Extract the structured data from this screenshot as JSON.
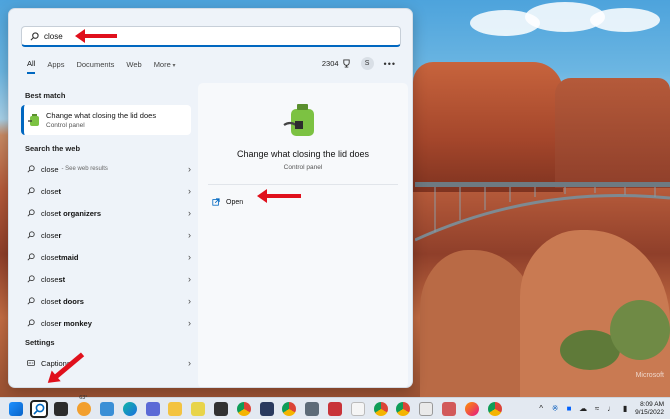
{
  "search": {
    "value": "close"
  },
  "tabs": [
    {
      "label": "All"
    },
    {
      "label": "Apps"
    },
    {
      "label": "Documents"
    },
    {
      "label": "Web"
    },
    {
      "label": "More"
    }
  ],
  "header_right": {
    "points": "2304",
    "avatar_initial": "S",
    "more_label": "•••"
  },
  "best_match": {
    "section_title": "Best match",
    "title": "Change what closing the lid does",
    "subtitle": "Control panel"
  },
  "web": {
    "section_title": "Search the web",
    "items": [
      {
        "prefix": "close",
        "bold": "",
        "sub": "- See web results"
      },
      {
        "prefix": "close",
        "bold": "t",
        "sub": ""
      },
      {
        "prefix": "close",
        "bold": "t organizers",
        "sub": ""
      },
      {
        "prefix": "close",
        "bold": "r",
        "sub": ""
      },
      {
        "prefix": "close",
        "bold": "tmaid",
        "sub": ""
      },
      {
        "prefix": "close",
        "bold": "st",
        "sub": ""
      },
      {
        "prefix": "close",
        "bold": "t doors",
        "sub": ""
      },
      {
        "prefix": "close",
        "bold": "r monkey",
        "sub": ""
      }
    ]
  },
  "settings": {
    "section_title": "Settings",
    "items": [
      {
        "label": "Captions"
      }
    ]
  },
  "detail": {
    "title": "Change what closing the lid does",
    "subtitle": "Control panel",
    "open_label": "Open"
  },
  "taskbar": {
    "weather_badge": "63°",
    "time": "8:09 AM",
    "date": "9/15/2022"
  },
  "wallpaper": {
    "logo_text": "Microsoft"
  },
  "colors": {
    "accent": "#0067c0",
    "annotation_arrow": "#e0101c"
  }
}
